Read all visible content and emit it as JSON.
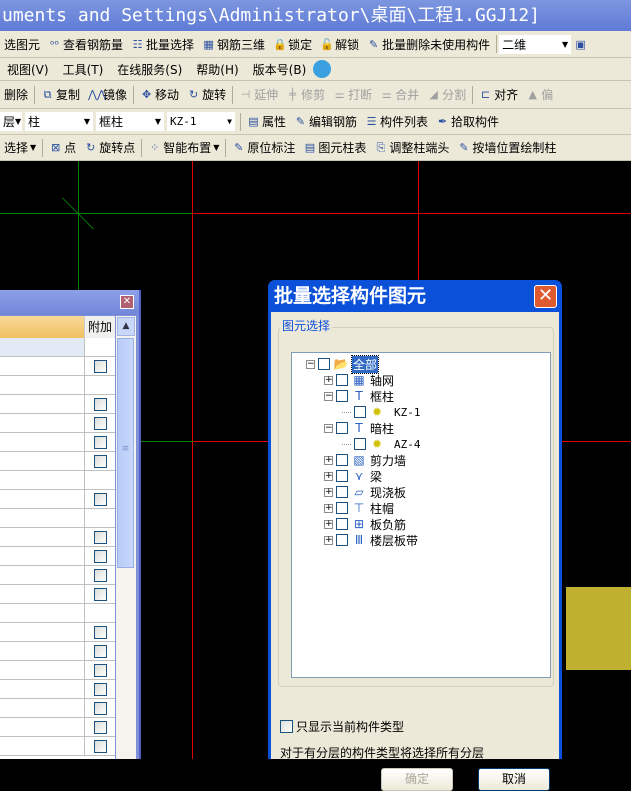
{
  "window": {
    "title": "uments and Settings\\Administrator\\桌面\\工程1.GGJ12]"
  },
  "toolbar1": [
    {
      "icon": "select-icon",
      "label": "选图元"
    },
    {
      "icon": "glasses-icon",
      "label": "查看钢筋量"
    },
    {
      "icon": "batch-select-icon",
      "label": "批量选择"
    },
    {
      "icon": "rebar-3d-icon",
      "label": "钢筋三维"
    },
    {
      "icon": "lock-icon",
      "label": "锁定"
    },
    {
      "icon": "unlock-icon",
      "label": "解锁"
    },
    {
      "icon": "brush-icon",
      "label": "批量删除未使用构件"
    }
  ],
  "view_mode": "二维",
  "menu": [
    "视图(V)",
    "工具(T)",
    "在线服务(S)",
    "帮助(H)",
    "版本号(B)"
  ],
  "toolbar2": [
    {
      "label": "删除",
      "disabled": false
    },
    {
      "label": "复制",
      "disabled": false
    },
    {
      "label": "镜像",
      "disabled": false
    },
    {
      "label": "移动",
      "disabled": false
    },
    {
      "label": "旋转",
      "disabled": false
    },
    {
      "label": "延伸",
      "disabled": true
    },
    {
      "label": "修剪",
      "disabled": true
    },
    {
      "label": "打断",
      "disabled": true
    },
    {
      "label": "合并",
      "disabled": true
    },
    {
      "label": "分割",
      "disabled": true
    },
    {
      "label": "对齐",
      "disabled": false
    },
    {
      "label": "偏",
      "disabled": true
    }
  ],
  "selectors": {
    "floor": "层",
    "type": "柱",
    "subtype": "框柱",
    "component": "KZ-1"
  },
  "toolbar3": [
    {
      "label": "属性"
    },
    {
      "label": "编辑钢筋"
    },
    {
      "label": "构件列表"
    },
    {
      "label": "拾取构件"
    }
  ],
  "toolbar4": [
    {
      "label": "选择"
    },
    {
      "label": "点"
    },
    {
      "label": "旋转点"
    },
    {
      "label": "智能布置"
    },
    {
      "label": "原位标注"
    },
    {
      "label": "图元柱表"
    },
    {
      "label": "调整柱端头"
    },
    {
      "label": "按墙位置绘制柱"
    }
  ],
  "left_panel": {
    "column_header": "附加",
    "rows_checkbox": [
      false,
      true,
      false,
      true,
      true,
      true,
      true,
      false,
      true,
      false,
      true,
      true,
      true,
      true,
      false,
      true,
      true,
      true,
      true,
      true,
      true,
      true
    ]
  },
  "dialog": {
    "title": "批量选择构件图元",
    "group_label": "图元选择",
    "tree": [
      {
        "label": "全部",
        "level": 0,
        "expander": "minus",
        "icon": "folder-icon",
        "selected": true
      },
      {
        "label": "轴网",
        "level": 1,
        "expander": "plus",
        "icon": "grid-icon"
      },
      {
        "label": "框柱",
        "level": 1,
        "expander": "minus",
        "icon": "column-icon"
      },
      {
        "label": "KZ-1",
        "level": 2,
        "expander": "",
        "icon": "component-icon"
      },
      {
        "label": "暗柱",
        "level": 1,
        "expander": "minus",
        "icon": "column-icon"
      },
      {
        "label": "AZ-4",
        "level": 2,
        "expander": "",
        "icon": "component-icon"
      },
      {
        "label": "剪力墙",
        "level": 1,
        "expander": "plus",
        "icon": "wall-icon"
      },
      {
        "label": "梁",
        "level": 1,
        "expander": "plus",
        "icon": "beam-icon"
      },
      {
        "label": "现浇板",
        "level": 1,
        "expander": "plus",
        "icon": "slab-icon"
      },
      {
        "label": "柱帽",
        "level": 1,
        "expander": "plus",
        "icon": "column-cap-icon"
      },
      {
        "label": "板负筋",
        "level": 1,
        "expander": "plus",
        "icon": "slab-rebar-icon"
      },
      {
        "label": "楼层板带",
        "level": 1,
        "expander": "plus",
        "icon": "slab-strip-icon"
      }
    ],
    "only_current_type": "只显示当前构件类型",
    "note": "对于有分层的构件类型将选择所有分层",
    "ok": "确定",
    "cancel": "取消"
  },
  "colors": {
    "canvas": "#000000",
    "axis_red": "#e00000",
    "axis_green": "#008000",
    "highlight_block": "#c0b030",
    "dialog_title": "#0a50d8"
  }
}
